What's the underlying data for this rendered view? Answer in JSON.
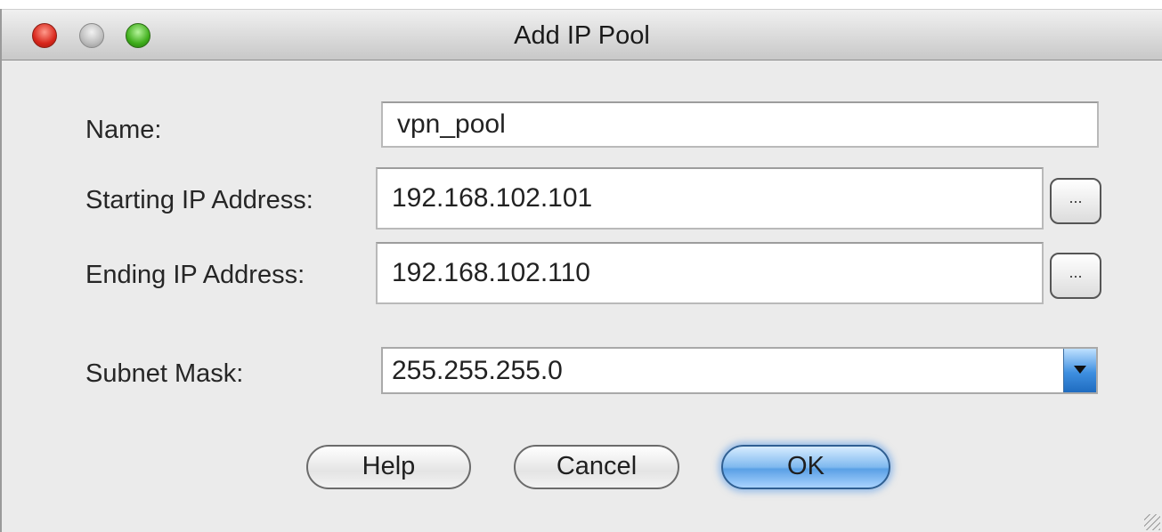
{
  "window": {
    "title": "Add IP Pool"
  },
  "form": {
    "name": {
      "label": "Name:",
      "value": "vpn_pool"
    },
    "start_ip": {
      "label": "Starting IP Address:",
      "value": "192.168.102.101",
      "browse_label": "..."
    },
    "end_ip": {
      "label": "Ending IP Address:",
      "value": "192.168.102.110",
      "browse_label": "..."
    },
    "subnet": {
      "label": "Subnet Mask:",
      "value": "255.255.255.0"
    }
  },
  "buttons": {
    "help": "Help",
    "cancel": "Cancel",
    "ok": "OK"
  },
  "colors": {
    "default_button": "#7fb9ef",
    "close_light": "#d8261b",
    "zoom_light": "#3fae1b"
  }
}
